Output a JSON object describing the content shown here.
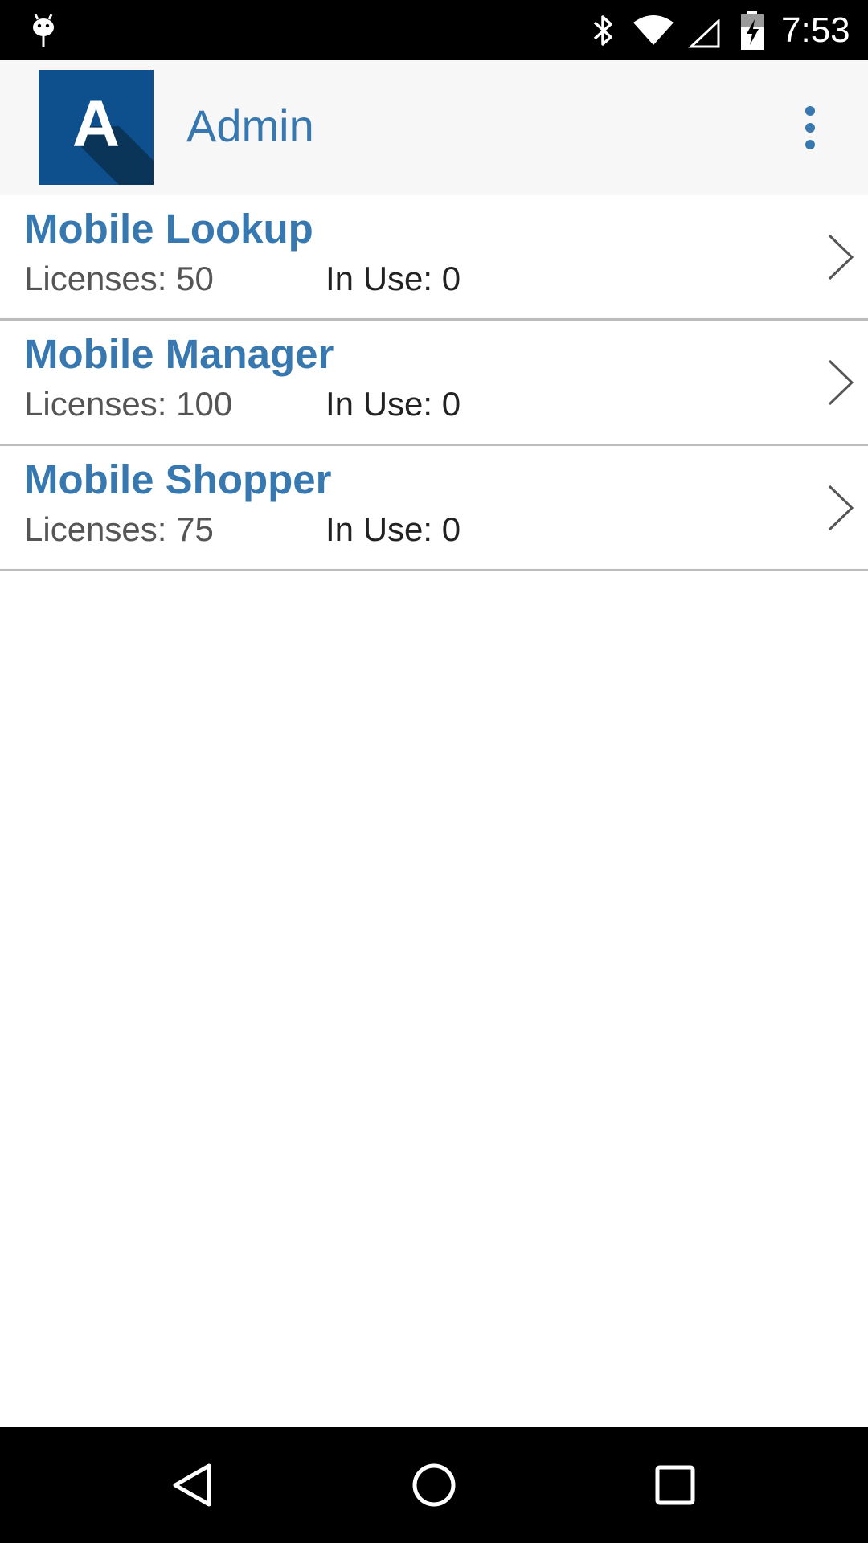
{
  "status_bar": {
    "time": "7:53",
    "icons": [
      "android-debug-icon",
      "bluetooth-icon",
      "wifi-icon",
      "cell-signal-icon",
      "battery-charging-icon"
    ]
  },
  "app_bar": {
    "logo_letter": "A",
    "title": "Admin",
    "menu_icon": "more-vert-icon",
    "logo_color": "#0e4f8e",
    "accent_color": "#3878b0"
  },
  "licenses": [
    {
      "name": "Mobile Lookup",
      "licenses": "Licenses: 50",
      "in_use": "In Use: 0"
    },
    {
      "name": "Mobile Manager",
      "licenses": "Licenses: 100",
      "in_use": "In Use: 0"
    },
    {
      "name": "Mobile Shopper",
      "licenses": "Licenses: 75",
      "in_use": "In Use: 0"
    }
  ],
  "nav_bar": {
    "icons": [
      "back-icon",
      "home-icon",
      "recents-icon"
    ]
  }
}
